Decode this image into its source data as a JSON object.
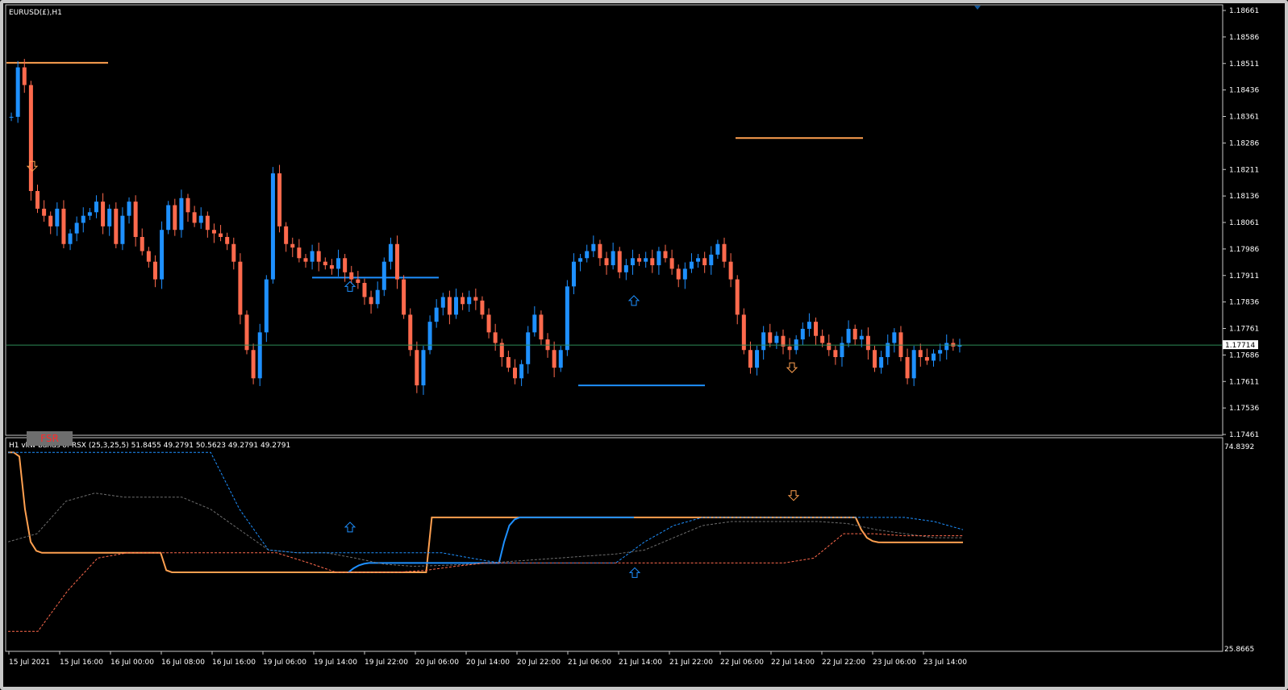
{
  "chart_window": {
    "title": "EURUSD(£),H1",
    "price_axis": [
      "1.18661",
      "1.18586",
      "1.18511",
      "1.18436",
      "1.18361",
      "1.18286",
      "1.18211",
      "1.18136",
      "1.18061",
      "1.17986",
      "1.17911",
      "1.17836",
      "1.17761",
      "1.17686",
      "1.17611",
      "1.17536",
      "1.17461"
    ],
    "current_price": "1.17714",
    "fsr_button": "FSR"
  },
  "indicator_window": {
    "title": "H1 vkw bands of RSX (25,3,25,5) 51.8455 49.2791 50.5623 49.2791 49.2791",
    "scale_top": "74.8392",
    "scale_bottom": "25.8665"
  },
  "time_axis": [
    "15 Jul 2021",
    "15 Jul 16:00",
    "16 Jul 00:00",
    "16 Jul 08:00",
    "16 Jul 16:00",
    "19 Jul 06:00",
    "19 Jul 14:00",
    "19 Jul 22:00",
    "20 Jul 06:00",
    "20 Jul 14:00",
    "20 Jul 22:00",
    "21 Jul 06:00",
    "21 Jul 14:00",
    "21 Jul 22:00",
    "22 Jul 06:00",
    "22 Jul 14:00",
    "22 Jul 22:00",
    "23 Jul 06:00",
    "23 Jul 14:00"
  ],
  "colors": {
    "bull": "#1e90ff",
    "bear": "#ff6a4d",
    "level": "#ffa050",
    "blue_level": "#1e90ff",
    "grid_text": "#ffffff",
    "price_line": "#2e8b57"
  },
  "chart_data": [
    {
      "type": "candlestick",
      "symbol": "EURUSD(£)",
      "timeframe": "H1",
      "ylim": [
        1.17461,
        1.18661
      ],
      "current_price": 1.17714,
      "close_path": [
        1.1836,
        1.185,
        1.1845,
        1.1815,
        1.181,
        1.1808,
        1.1805,
        1.181,
        1.18,
        1.1803,
        1.1806,
        1.1808,
        1.1809,
        1.1812,
        1.1805,
        1.181,
        1.18,
        1.1808,
        1.1812,
        1.1802,
        1.1798,
        1.1795,
        1.179,
        1.1804,
        1.1811,
        1.1804,
        1.1813,
        1.1809,
        1.1806,
        1.1808,
        1.1804,
        1.1803,
        1.1802,
        1.18,
        1.1795,
        1.178,
        1.177,
        1.1762,
        1.1775,
        1.179,
        1.182,
        1.1805,
        1.18,
        1.1799,
        1.1796,
        1.1795,
        1.1798,
        1.1795,
        1.1794,
        1.1793,
        1.1796,
        1.1792,
        1.179,
        1.1789,
        1.1785,
        1.1783,
        1.1787,
        1.1795,
        1.18,
        1.179,
        1.178,
        1.177,
        1.176,
        1.177,
        1.1778,
        1.1782,
        1.1785,
        1.178,
        1.1785,
        1.1783,
        1.1785,
        1.1784,
        1.178,
        1.1775,
        1.1772,
        1.1768,
        1.1765,
        1.1762,
        1.1766,
        1.1775,
        1.178,
        1.1773,
        1.177,
        1.1765,
        1.177,
        1.1788,
        1.1795,
        1.1796,
        1.1798,
        1.18,
        1.1796,
        1.1794,
        1.1798,
        1.1792,
        1.1794,
        1.1796,
        1.1795,
        1.1796,
        1.1794,
        1.1798,
        1.1796,
        1.1793,
        1.179,
        1.1793,
        1.1795,
        1.1796,
        1.1794,
        1.1797,
        1.18,
        1.1795,
        1.179,
        1.178,
        1.177,
        1.1765,
        1.177,
        1.1775,
        1.1772,
        1.1774,
        1.1771,
        1.177,
        1.1773,
        1.1776,
        1.1778,
        1.1774,
        1.1772,
        1.177,
        1.1768,
        1.1772,
        1.1776,
        1.1773,
        1.1774,
        1.177,
        1.1765,
        1.1768,
        1.1772,
        1.1775,
        1.1768,
        1.1762,
        1.177,
        1.1768,
        1.1767,
        1.1769,
        1.177,
        1.1772,
        1.1771,
        1.17714
      ],
      "levels": [
        {
          "color": "orange",
          "price": 1.18513
        },
        {
          "color": "orange",
          "price": 1.183
        },
        {
          "color": "blue",
          "price": 1.17905
        },
        {
          "color": "blue",
          "price": 1.176
        }
      ],
      "arrows": [
        {
          "direction": "down",
          "color": "orange",
          "price": 1.1822
        },
        {
          "direction": "up",
          "color": "blue",
          "price": 1.1788
        },
        {
          "direction": "up",
          "color": "blue",
          "price": 1.1784
        },
        {
          "direction": "down",
          "color": "orange",
          "price": 1.1765
        }
      ]
    },
    {
      "type": "line",
      "title": "H1 vkw bands of RSX (25,3,25,5)",
      "ylim": [
        25.8665,
        74.8392
      ],
      "series": [
        {
          "color": "#ffa050",
          "style": "solid",
          "values": [
            74,
            74,
            73,
            60,
            52,
            49.8,
            49.3,
            49.3,
            49.3,
            49.3,
            49.3,
            49.3,
            49.3,
            49.3,
            49.3,
            49.3,
            49.3,
            49.3,
            49.3,
            49.3,
            49.3,
            49.3,
            49.3,
            49.3,
            49.3,
            49.3,
            49.3,
            49.3,
            45,
            44.5,
            44.5,
            44.5,
            44.5,
            44.5,
            44.5,
            44.5,
            44.5,
            44.5,
            44.5,
            44.5,
            44.5,
            44.5,
            44.5,
            44.5,
            44.5,
            44.5,
            44.5,
            44.5,
            44.5,
            44.5,
            44.5,
            44.5,
            44.5,
            44.5,
            44.5,
            44.5,
            44.5,
            44.5,
            44.5,
            44.5,
            44.5,
            44.5,
            44.5,
            44.5,
            44.5,
            44.5,
            44.5,
            44.5,
            44.5,
            44.5,
            44.5,
            44.5,
            44.5,
            44.5,
            44.5,
            58,
            58,
            58,
            58,
            58,
            58,
            58,
            58,
            58,
            58,
            58,
            58,
            58,
            58,
            58,
            58,
            58,
            58,
            58,
            58,
            58,
            58,
            58,
            58,
            58,
            58,
            58,
            58,
            58,
            58,
            58,
            58,
            58,
            58,
            58,
            58,
            58,
            58,
            58,
            58,
            58,
            58,
            58,
            58,
            58,
            58,
            58,
            58,
            58,
            58,
            58,
            58,
            58,
            58,
            58,
            58,
            58,
            58,
            58,
            58,
            58,
            58,
            58,
            58,
            58,
            58,
            58,
            58,
            58,
            58,
            58,
            58,
            58,
            58,
            58,
            58,
            55,
            53,
            52.2,
            51.9,
            51.85,
            51.85,
            51.85,
            51.85,
            51.85,
            51.85,
            51.85,
            51.85,
            51.85,
            51.85,
            51.85,
            51.85,
            51.85,
            51.85,
            51.85
          ]
        },
        {
          "color": "#1e90ff",
          "style": "solid",
          "values": [
            44.5,
            45.5,
            46.2,
            46.6,
            46.8,
            46.8,
            46.8,
            46.8,
            46.8,
            46.8,
            46.8,
            46.8,
            46.8,
            46.8,
            46.8,
            46.8,
            46.8,
            46.8,
            46.8,
            46.8,
            46.8,
            46.8,
            46.8,
            46.8,
            46.8,
            46.8,
            46.8,
            46.8,
            46.8,
            46.8,
            52,
            56,
            57.5,
            58,
            58,
            58,
            58,
            58,
            58,
            58,
            58,
            58,
            58,
            58,
            58,
            58,
            58,
            58,
            58,
            58,
            58,
            58,
            58,
            58,
            58,
            58
          ]
        },
        {
          "color": "#6e6e6e",
          "style": "dashed",
          "values": [
            52,
            54,
            62,
            64,
            63,
            63,
            63,
            60,
            55,
            50,
            49.3,
            49.3,
            48,
            46.5,
            46,
            46.2,
            46.5,
            47,
            47.5,
            48,
            48.5,
            49,
            50,
            53,
            56,
            57,
            57,
            57,
            57,
            56.5,
            55,
            54,
            53,
            53
          ]
        },
        {
          "color": "#1e90ff",
          "style": "dashed",
          "values": [
            74,
            74,
            74,
            74,
            74,
            74,
            74,
            74,
            60,
            50,
            49.3,
            49.3,
            49.3,
            49.3,
            49.3,
            49.3,
            48,
            46.8,
            46.8,
            46.8,
            46.8,
            46.8,
            52,
            56,
            58,
            58,
            58,
            58,
            58,
            58,
            58,
            58,
            57,
            55
          ]
        },
        {
          "color": "#ff6a4d",
          "style": "dashed",
          "values": [
            30,
            30,
            40,
            48,
            49.3,
            49.3,
            49.3,
            49.3,
            49.3,
            49.3,
            47,
            44.5,
            44.5,
            44.5,
            45,
            46,
            46.8,
            46.8,
            46.8,
            46.8,
            46.8,
            46.8,
            46.8,
            46.8,
            46.8,
            46.8,
            46.8,
            48,
            54,
            54,
            53.5,
            53.5,
            53.5
          ]
        }
      ]
    }
  ]
}
